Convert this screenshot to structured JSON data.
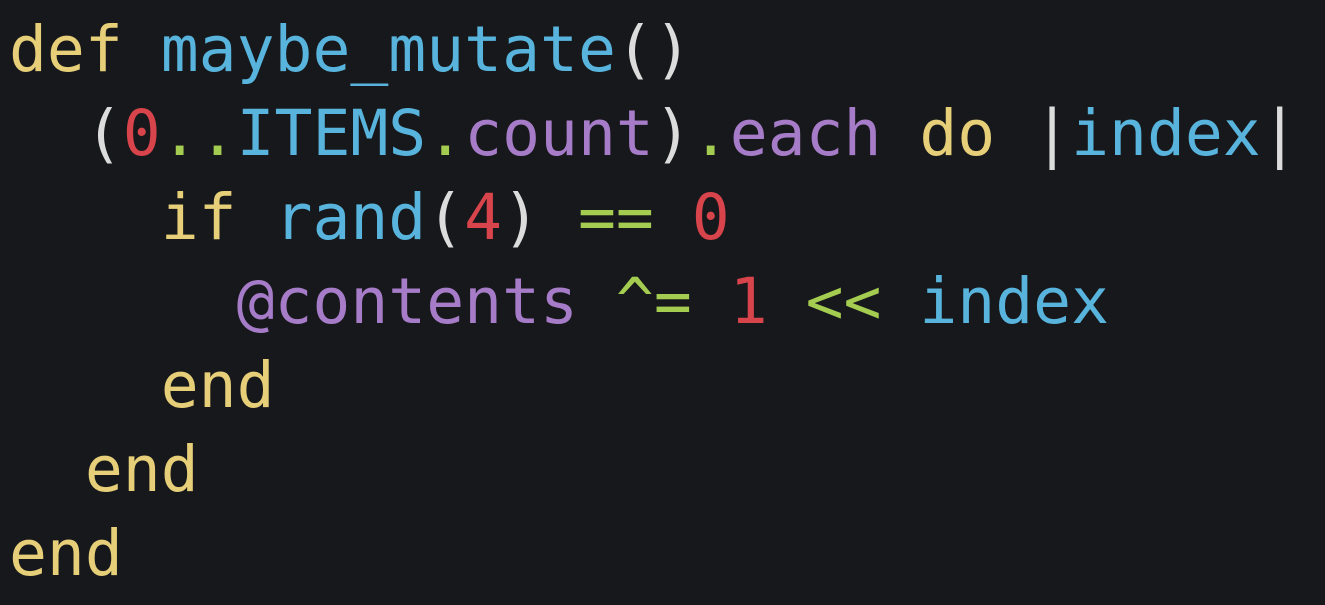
{
  "colors": {
    "background": "#17181b",
    "keyword": "#e6cf78",
    "identifier": "#58b4dc",
    "number": "#d7444b",
    "operator": "#a4cc50",
    "member": "#a67cc8",
    "punctuation": "#dcdcdc"
  },
  "code": {
    "lines": [
      {
        "indent": "",
        "tokens": [
          {
            "type": "kw",
            "text": "def"
          },
          {
            "type": "pun",
            "text": " "
          },
          {
            "type": "fn",
            "text": "maybe_mutate"
          },
          {
            "type": "pun",
            "text": "()"
          }
        ]
      },
      {
        "indent": "  ",
        "tokens": [
          {
            "type": "pun",
            "text": "("
          },
          {
            "type": "num",
            "text": "0"
          },
          {
            "type": "op",
            "text": ".."
          },
          {
            "type": "fn",
            "text": "ITEMS"
          },
          {
            "type": "op",
            "text": "."
          },
          {
            "type": "mem",
            "text": "count"
          },
          {
            "type": "pun",
            "text": ")"
          },
          {
            "type": "op",
            "text": "."
          },
          {
            "type": "mem",
            "text": "each"
          },
          {
            "type": "pun",
            "text": " "
          },
          {
            "type": "kw",
            "text": "do"
          },
          {
            "type": "pun",
            "text": " |"
          },
          {
            "type": "fn",
            "text": "index"
          },
          {
            "type": "pun",
            "text": "|"
          }
        ]
      },
      {
        "indent": "    ",
        "tokens": [
          {
            "type": "kw",
            "text": "if"
          },
          {
            "type": "pun",
            "text": " "
          },
          {
            "type": "fn",
            "text": "rand"
          },
          {
            "type": "pun",
            "text": "("
          },
          {
            "type": "num",
            "text": "4"
          },
          {
            "type": "pun",
            "text": ") "
          },
          {
            "type": "op",
            "text": "=="
          },
          {
            "type": "pun",
            "text": " "
          },
          {
            "type": "num",
            "text": "0"
          }
        ]
      },
      {
        "indent": "      ",
        "tokens": [
          {
            "type": "mem",
            "text": "@contents"
          },
          {
            "type": "pun",
            "text": " "
          },
          {
            "type": "op",
            "text": "^="
          },
          {
            "type": "pun",
            "text": " "
          },
          {
            "type": "num",
            "text": "1"
          },
          {
            "type": "pun",
            "text": " "
          },
          {
            "type": "op",
            "text": "<<"
          },
          {
            "type": "pun",
            "text": " "
          },
          {
            "type": "fn",
            "text": "index"
          }
        ]
      },
      {
        "indent": "    ",
        "tokens": [
          {
            "type": "kw",
            "text": "end"
          }
        ]
      },
      {
        "indent": "  ",
        "tokens": [
          {
            "type": "kw",
            "text": "end"
          }
        ]
      },
      {
        "indent": "",
        "tokens": [
          {
            "type": "kw",
            "text": "end"
          }
        ]
      }
    ]
  }
}
